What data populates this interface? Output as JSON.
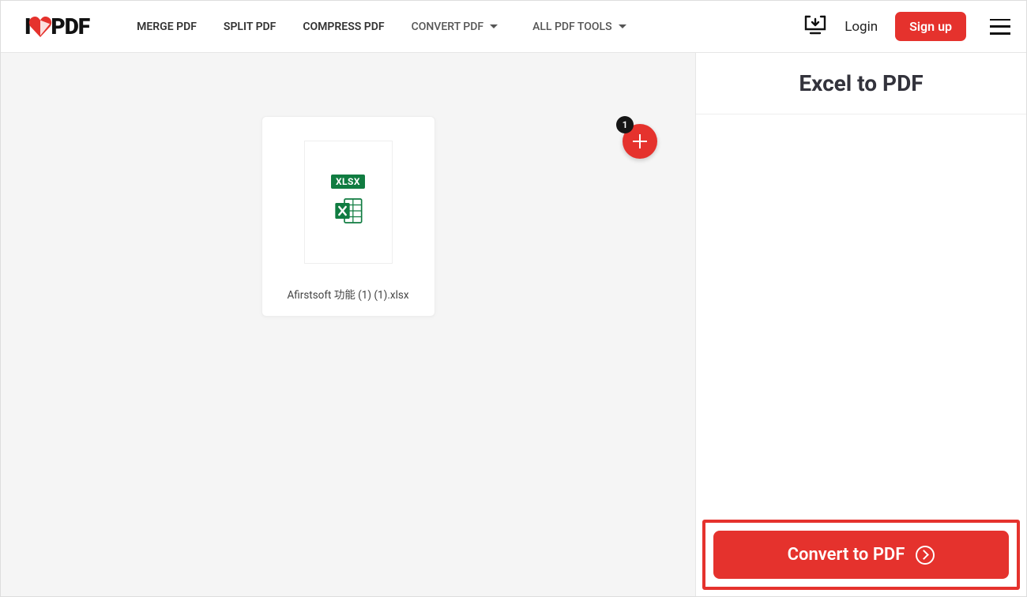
{
  "header": {
    "logo_left": "I",
    "logo_right": "PDF",
    "nav": {
      "merge": "MERGE PDF",
      "split": "SPLIT PDF",
      "compress": "COMPRESS PDF",
      "convert": "CONVERT PDF",
      "all_tools": "ALL PDF TOOLS"
    },
    "login": "Login",
    "signup": "Sign up"
  },
  "main": {
    "file": {
      "badge": "XLSX",
      "name": "Afirstsoft 功能 (1) (1).xlsx"
    },
    "add_badge_count": "1"
  },
  "sidebar": {
    "title": "Excel to PDF",
    "convert_label": "Convert to PDF"
  }
}
